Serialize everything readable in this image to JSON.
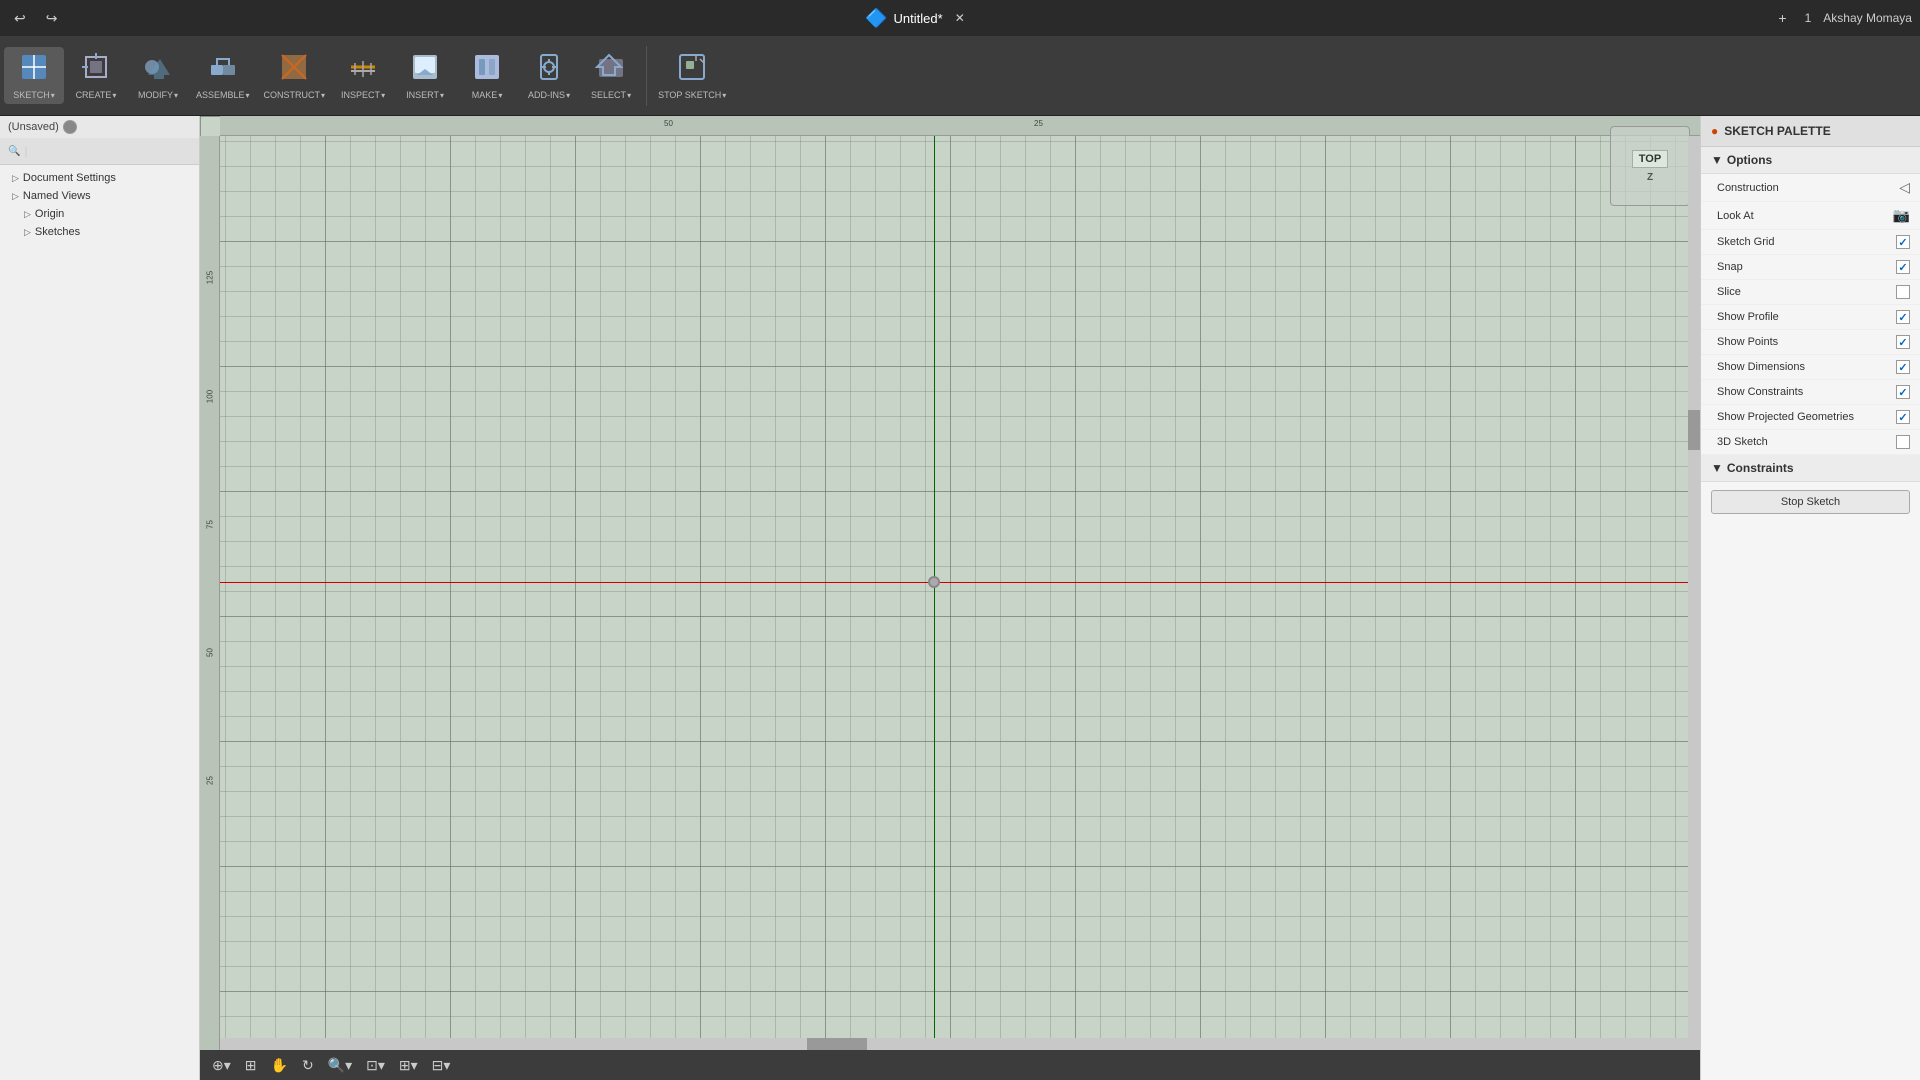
{
  "titlebar": {
    "undo_label": "↩",
    "redo_label": "↪",
    "app_icon": "🔷",
    "title": "Untitled*",
    "close_label": "✕",
    "add_label": "+",
    "version_label": "1",
    "user_label": "Akshay Momaya"
  },
  "toolbar": {
    "groups": [
      {
        "id": "sketch",
        "icon": "✏️",
        "label": "SKETCH",
        "has_arrow": true
      },
      {
        "id": "create",
        "icon": "🔲",
        "label": "CREATE",
        "has_arrow": true
      },
      {
        "id": "modify",
        "icon": "🔧",
        "label": "MODIFY",
        "has_arrow": true
      },
      {
        "id": "assemble",
        "icon": "🔩",
        "label": "ASSEMBLE",
        "has_arrow": true
      },
      {
        "id": "construct",
        "icon": "📐",
        "label": "CONSTRUCT",
        "has_arrow": true
      },
      {
        "id": "inspect",
        "icon": "📏",
        "label": "INSPECT",
        "has_arrow": true
      },
      {
        "id": "insert",
        "icon": "🖼️",
        "label": "INSERT",
        "has_arrow": true
      },
      {
        "id": "make",
        "icon": "🔨",
        "label": "MAKE",
        "has_arrow": true
      },
      {
        "id": "addins",
        "icon": "⚙️",
        "label": "ADD-INS",
        "has_arrow": true
      },
      {
        "id": "select",
        "icon": "🖱️",
        "label": "SELECT",
        "has_arrow": true
      },
      {
        "id": "stopsketch",
        "icon": "⏹️",
        "label": "STOP SKETCH",
        "has_arrow": true
      }
    ]
  },
  "sidebar": {
    "unsaved_label": "(Unsaved)",
    "items": [
      {
        "id": "document-settings",
        "label": "Document Settings",
        "icon": "▷",
        "indent": 0
      },
      {
        "id": "named-views",
        "label": "Named Views",
        "icon": "▷",
        "indent": 0
      },
      {
        "id": "origin",
        "label": "Origin",
        "icon": "▷",
        "indent": 1
      },
      {
        "id": "sketches",
        "label": "Sketches",
        "icon": "▷",
        "indent": 1
      }
    ]
  },
  "canvas": {
    "ruler_marks_h": [
      "50",
      "25"
    ],
    "ruler_marks_v": [
      "125",
      "100",
      "75",
      "50",
      "25"
    ],
    "axis_color_v": "#006600",
    "axis_color_h": "#cc0000"
  },
  "nav_cube": {
    "label": "TOP",
    "z_label": "Z"
  },
  "sketch_palette": {
    "title": "SKETCH PALETTE",
    "options_section": "Options",
    "constraints_section": "Constraints",
    "stop_sketch_label": "Stop Sketch",
    "items": [
      {
        "id": "construction",
        "label": "Construction",
        "checked": false,
        "icon": "◁"
      },
      {
        "id": "look-at",
        "label": "Look At",
        "checked": false,
        "icon": "📷"
      },
      {
        "id": "sketch-grid",
        "label": "Sketch Grid",
        "checked": true
      },
      {
        "id": "snap",
        "label": "Snap",
        "checked": true
      },
      {
        "id": "slice",
        "label": "Slice",
        "checked": false
      },
      {
        "id": "show-profile",
        "label": "Show Profile",
        "checked": true
      },
      {
        "id": "show-points",
        "label": "Show Points",
        "checked": true
      },
      {
        "id": "show-dimensions",
        "label": "Show Dimensions",
        "checked": true
      },
      {
        "id": "show-constraints",
        "label": "Show Constraints",
        "checked": true
      },
      {
        "id": "show-projected-geometries",
        "label": "Show Projected Geometries",
        "checked": true
      },
      {
        "id": "3d-sketch",
        "label": "3D Sketch",
        "checked": false
      }
    ]
  },
  "bottom_toolbar": {
    "buttons": [
      "⊕",
      "⊞",
      "🔍",
      "↔",
      "⊡",
      "⊞",
      "⊟"
    ]
  },
  "colors": {
    "toolbar_bg": "#3c3c3c",
    "sidebar_bg": "#f0f0f0",
    "canvas_bg": "#c8d4c8",
    "palette_bg": "#f5f5f5",
    "accent_blue": "#0066cc"
  }
}
